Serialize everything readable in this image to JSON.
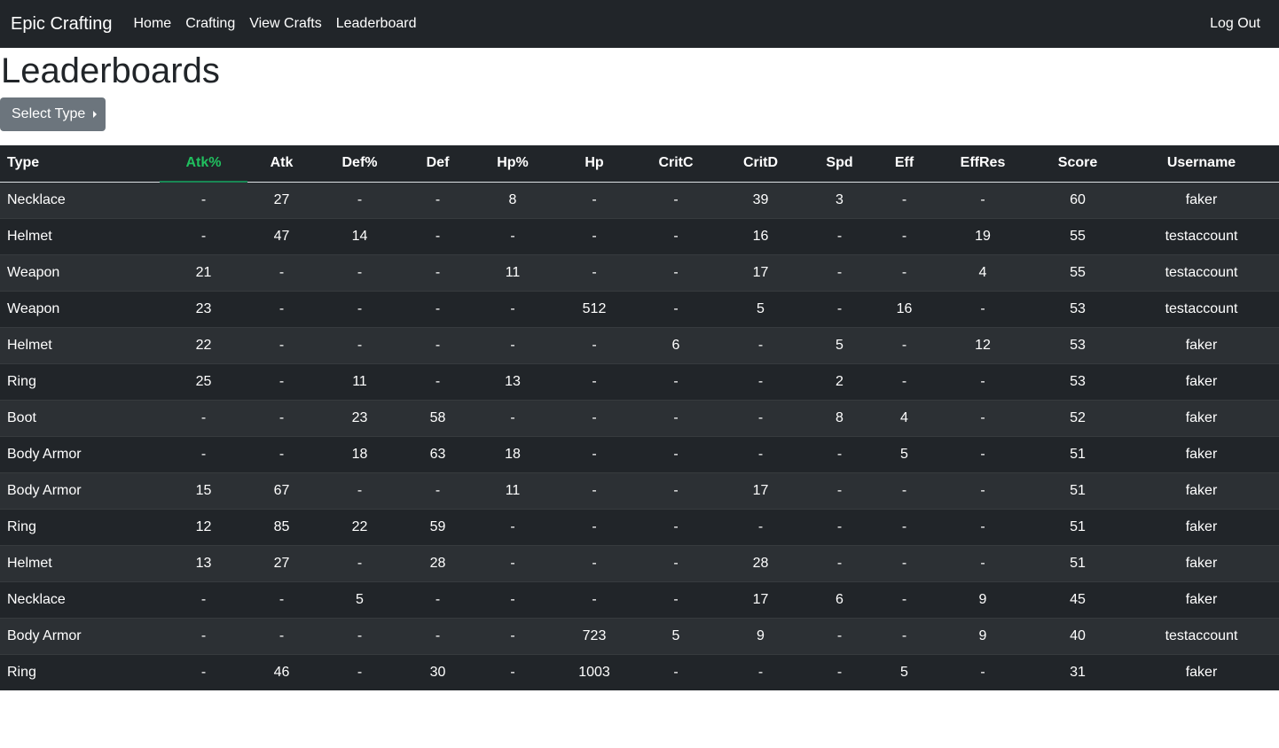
{
  "navbar": {
    "brand": "Epic Crafting",
    "links": [
      "Home",
      "Crafting",
      "View Crafts",
      "Leaderboard"
    ],
    "logout": "Log Out"
  },
  "page": {
    "title": "Leaderboards",
    "select_type_label": "Select Type"
  },
  "table": {
    "sorted_column": "Atk%",
    "headers": [
      "Type",
      "Atk%",
      "Atk",
      "Def%",
      "Def",
      "Hp%",
      "Hp",
      "CritC",
      "CritD",
      "Spd",
      "Eff",
      "EffRes",
      "Score",
      "Username"
    ],
    "rows": [
      [
        "Necklace",
        "-",
        "27",
        "-",
        "-",
        "8",
        "-",
        "-",
        "39",
        "3",
        "-",
        "-",
        "60",
        "faker"
      ],
      [
        "Helmet",
        "-",
        "47",
        "14",
        "-",
        "-",
        "-",
        "-",
        "16",
        "-",
        "-",
        "19",
        "55",
        "testaccount"
      ],
      [
        "Weapon",
        "21",
        "-",
        "-",
        "-",
        "11",
        "-",
        "-",
        "17",
        "-",
        "-",
        "4",
        "55",
        "testaccount"
      ],
      [
        "Weapon",
        "23",
        "-",
        "-",
        "-",
        "-",
        "512",
        "-",
        "5",
        "-",
        "16",
        "-",
        "53",
        "testaccount"
      ],
      [
        "Helmet",
        "22",
        "-",
        "-",
        "-",
        "-",
        "-",
        "6",
        "-",
        "5",
        "-",
        "12",
        "53",
        "faker"
      ],
      [
        "Ring",
        "25",
        "-",
        "11",
        "-",
        "13",
        "-",
        "-",
        "-",
        "2",
        "-",
        "-",
        "53",
        "faker"
      ],
      [
        "Boot",
        "-",
        "-",
        "23",
        "58",
        "-",
        "-",
        "-",
        "-",
        "8",
        "4",
        "-",
        "52",
        "faker"
      ],
      [
        "Body Armor",
        "-",
        "-",
        "18",
        "63",
        "18",
        "-",
        "-",
        "-",
        "-",
        "5",
        "-",
        "51",
        "faker"
      ],
      [
        "Body Armor",
        "15",
        "67",
        "-",
        "-",
        "11",
        "-",
        "-",
        "17",
        "-",
        "-",
        "-",
        "51",
        "faker"
      ],
      [
        "Ring",
        "12",
        "85",
        "22",
        "59",
        "-",
        "-",
        "-",
        "-",
        "-",
        "-",
        "-",
        "51",
        "faker"
      ],
      [
        "Helmet",
        "13",
        "27",
        "-",
        "28",
        "-",
        "-",
        "-",
        "28",
        "-",
        "-",
        "-",
        "51",
        "faker"
      ],
      [
        "Necklace",
        "-",
        "-",
        "5",
        "-",
        "-",
        "-",
        "-",
        "17",
        "6",
        "-",
        "9",
        "45",
        "faker"
      ],
      [
        "Body Armor",
        "-",
        "-",
        "-",
        "-",
        "-",
        "723",
        "5",
        "9",
        "-",
        "-",
        "9",
        "40",
        "testaccount"
      ],
      [
        "Ring",
        "-",
        "46",
        "-",
        "30",
        "-",
        "1003",
        "-",
        "-",
        "-",
        "5",
        "-",
        "31",
        "faker"
      ]
    ]
  },
  "colors": {
    "navbar_bg": "#212529",
    "sorted_header": "#20c05f",
    "button_bg": "#6c757d"
  }
}
